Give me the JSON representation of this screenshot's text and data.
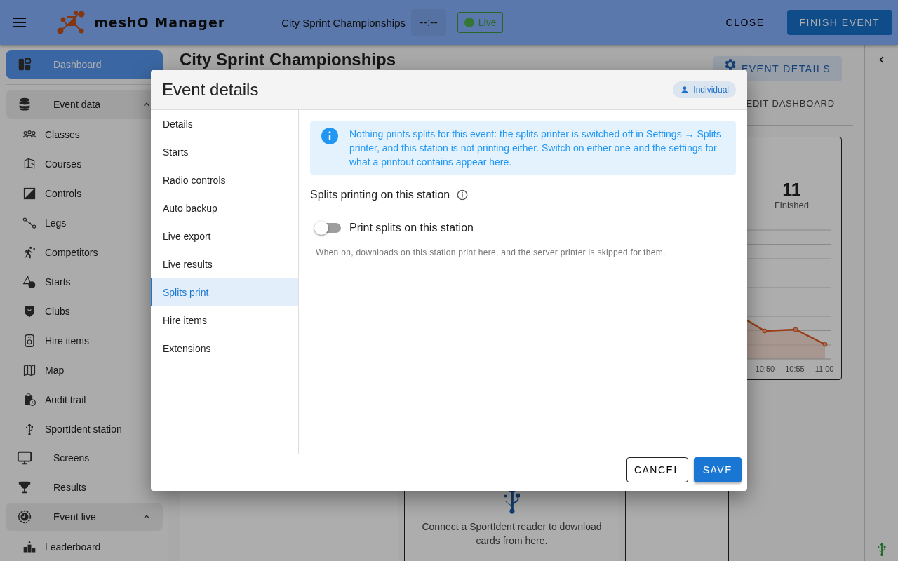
{
  "app_bar": {
    "app_name": "meshO Manager",
    "event_name": "City Sprint Championships",
    "clock": "--:--",
    "live_badge": {
      "label": "Live",
      "on": true
    },
    "close_button": "CLOSE",
    "finish_button": "FINISH EVENT"
  },
  "sidebar": {
    "items": [
      {
        "label": "Dashboard",
        "selected": true
      },
      {
        "label": "Event data",
        "selected": false,
        "expanded": true,
        "children": [
          {
            "label": "Classes",
            "selected": false
          },
          {
            "label": "Courses",
            "selected": false
          },
          {
            "label": "Controls",
            "selected": false
          },
          {
            "label": "Legs",
            "selected": false
          },
          {
            "label": "Competitors",
            "selected": false
          },
          {
            "label": "Starts",
            "selected": false
          },
          {
            "label": "Clubs",
            "selected": false
          },
          {
            "label": "Hire items",
            "selected": false
          },
          {
            "label": "Map",
            "selected": false
          },
          {
            "label": "Audit trail",
            "selected": false
          },
          {
            "label": "SportIdent station",
            "selected": false
          }
        ]
      },
      {
        "label": "Screens",
        "selected": false
      },
      {
        "label": "Results",
        "selected": false
      },
      {
        "label": "Event live",
        "selected": false,
        "expanded": true,
        "children": [
          {
            "label": "Leaderboard",
            "selected": false
          }
        ]
      }
    ]
  },
  "dashboard": {
    "title": "City Sprint Championships",
    "event_details_button": "EVENT DETAILS",
    "edit_button": "EDIT DASHBOARD",
    "finished_card": {
      "value": "11",
      "label": "Finished",
      "time_labels": [
        "10:50",
        "10:55",
        "11:00"
      ]
    },
    "reader_card": {
      "message": "Connect a SportIdent reader to download cards from here."
    }
  },
  "dialog": {
    "title": "Event details",
    "mode_chip": "Individual",
    "nav": [
      {
        "label": "Details",
        "selected": false
      },
      {
        "label": "Starts",
        "selected": false
      },
      {
        "label": "Radio controls",
        "selected": false
      },
      {
        "label": "Auto backup",
        "selected": false
      },
      {
        "label": "Live export",
        "selected": false
      },
      {
        "label": "Live results",
        "selected": false
      },
      {
        "label": "Splits print",
        "selected": true
      },
      {
        "label": "Hire items",
        "selected": false
      },
      {
        "label": "Extensions",
        "selected": false
      }
    ],
    "info": "Nothing prints splits for this event: the splits printer is switched off in Settings → Splits printer, and this station is not printing either. Switch on either one and the settings for what a printout contains appear here.",
    "section_title": "Splits printing on this station",
    "toggle": {
      "label": "Print splits on this station",
      "on": false
    },
    "help": "When on, downloads on this station print here, and the server printer is skipped for them.",
    "cancel_button": "CANCEL",
    "save_button": "SAVE"
  }
}
